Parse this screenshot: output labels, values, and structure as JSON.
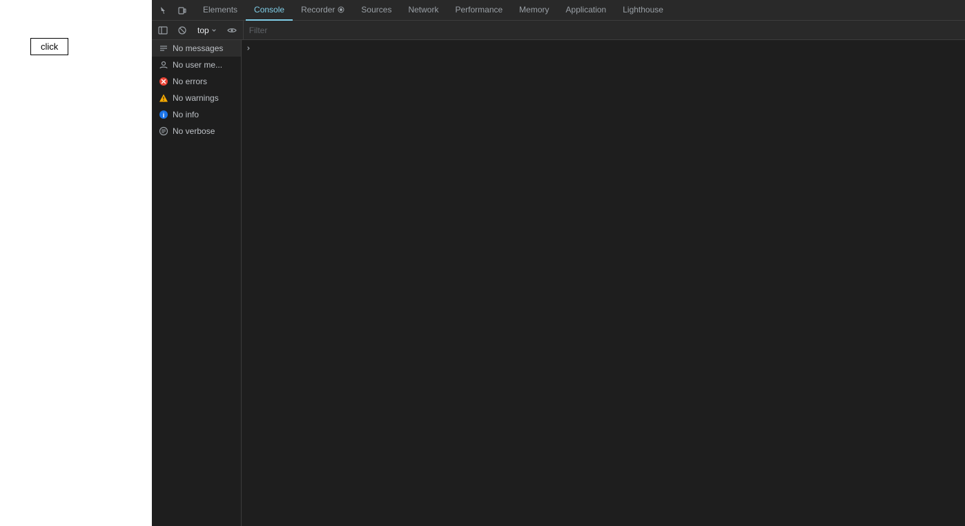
{
  "page": {
    "click_button_label": "click"
  },
  "devtools": {
    "tabs": [
      {
        "id": "elements",
        "label": "Elements",
        "active": false
      },
      {
        "id": "console",
        "label": "Console",
        "active": true
      },
      {
        "id": "recorder",
        "label": "Recorder",
        "active": false,
        "has_icon": true
      },
      {
        "id": "sources",
        "label": "Sources",
        "active": false
      },
      {
        "id": "network",
        "label": "Network",
        "active": false
      },
      {
        "id": "performance",
        "label": "Performance",
        "active": false
      },
      {
        "id": "memory",
        "label": "Memory",
        "active": false
      },
      {
        "id": "application",
        "label": "Application",
        "active": false
      },
      {
        "id": "lighthouse",
        "label": "Lighthouse",
        "active": false
      }
    ],
    "toolbar": {
      "context_label": "top",
      "filter_placeholder": "Filter"
    },
    "sidebar": {
      "items": [
        {
          "id": "messages",
          "label": "No messages",
          "icon": "messages"
        },
        {
          "id": "user",
          "label": "No user me...",
          "icon": "user"
        },
        {
          "id": "errors",
          "label": "No errors",
          "icon": "error"
        },
        {
          "id": "warnings",
          "label": "No warnings",
          "icon": "warning"
        },
        {
          "id": "info",
          "label": "No info",
          "icon": "info"
        },
        {
          "id": "verbose",
          "label": "No verbose",
          "icon": "verbose"
        }
      ]
    }
  }
}
